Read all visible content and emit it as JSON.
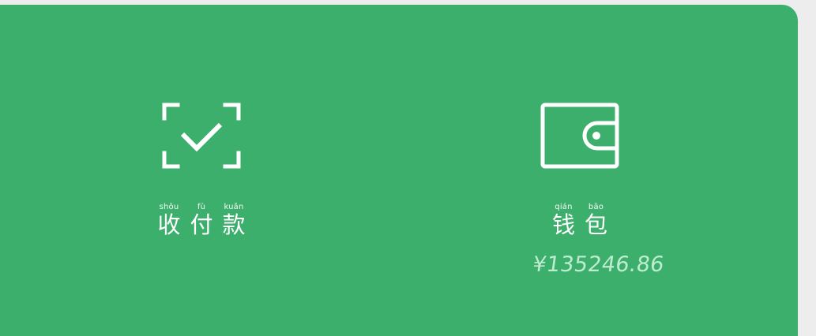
{
  "colors": {
    "panel_bg": "#3daf6c",
    "page_bg": "#ededed",
    "icon": "#ffffff",
    "balance_text": "#bdeccf"
  },
  "tiles": [
    {
      "id": "pay",
      "icon": "scan-check-icon",
      "label": [
        {
          "pinyin": "shōu",
          "hanzi": "收"
        },
        {
          "pinyin": "fù",
          "hanzi": "付"
        },
        {
          "pinyin": "kuǎn",
          "hanzi": "款"
        }
      ]
    },
    {
      "id": "wallet",
      "icon": "wallet-icon",
      "label": [
        {
          "pinyin": "qián",
          "hanzi": "钱"
        },
        {
          "pinyin": "bāo",
          "hanzi": "包"
        }
      ],
      "balance": "¥135246.86"
    }
  ]
}
